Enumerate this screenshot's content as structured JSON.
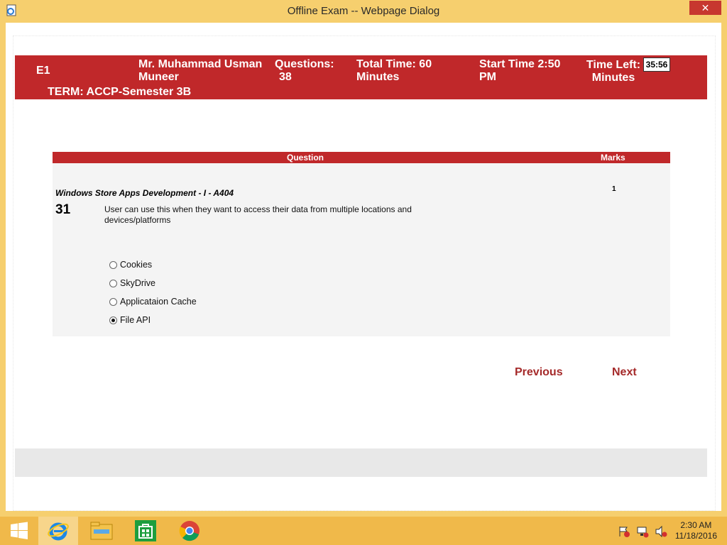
{
  "window": {
    "title": "Offline Exam -- Webpage Dialog",
    "close_label": "✕"
  },
  "header": {
    "exam_code": "E1",
    "teacher_line1": "Mr. Muhammad Usman",
    "teacher_line2": "Muneer",
    "questions_label": "Questions:",
    "questions_count": "38",
    "total_time_line1": "Total Time:  60",
    "total_time_line2": "Minutes",
    "start_time_line1": "Start Time  2:50",
    "start_time_line2": "PM",
    "time_left_label": "Time Left:",
    "time_left_value": "35:56",
    "time_left_unit": "Minutes",
    "term": "TERM: ACCP-Semester 3B"
  },
  "question_table": {
    "question_header": "Question",
    "marks_header": "Marks",
    "subject": "Windows Store Apps Development - I - A404",
    "marks": "1",
    "number": "31",
    "text": "User can use this when they want to access their data from multiple locations and devices/platforms",
    "options": [
      {
        "label": "Cookies",
        "checked": false
      },
      {
        "label": "SkyDrive",
        "checked": false
      },
      {
        "label": "Applicataion Cache",
        "checked": false
      },
      {
        "label": "File API",
        "checked": true
      }
    ]
  },
  "navigation": {
    "previous_label": "Previous",
    "next_label": "Next"
  },
  "taskbar": {
    "apps": [
      "windows-start-icon",
      "internet-explorer-icon",
      "file-explorer-icon",
      "windows-store-icon",
      "chrome-icon"
    ],
    "tray_icons": [
      "action-center-flag-icon",
      "network-icon",
      "speaker-muted-icon"
    ],
    "time": "2:30 AM",
    "date": "11/18/2016"
  },
  "colors": {
    "header_red": "#c0282a",
    "link_red": "#a52a2a",
    "window_frame": "#f6cf6e"
  }
}
